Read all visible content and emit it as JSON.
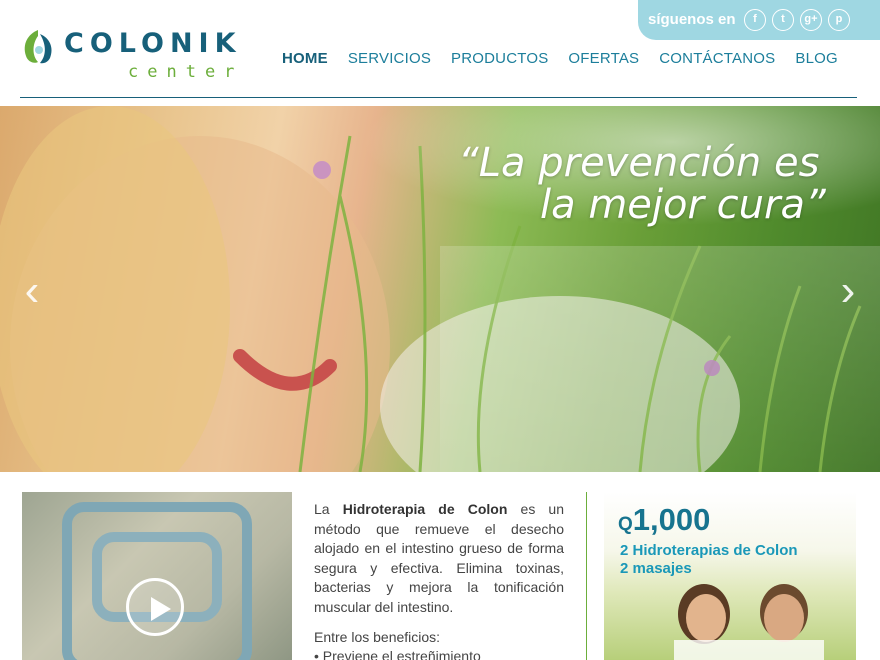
{
  "brand": {
    "name": "COLONIK",
    "sub": "center",
    "colors": {
      "primary": "#17607a",
      "accent": "#6cae3b",
      "link": "#1c7e9b",
      "social_bg": "#9fd7e2"
    }
  },
  "social": {
    "label": "síguenos en",
    "icons": [
      {
        "name": "facebook-icon",
        "glyph": "f"
      },
      {
        "name": "twitter-icon",
        "glyph": "t"
      },
      {
        "name": "google-plus-icon",
        "glyph": "g+"
      },
      {
        "name": "pinterest-icon",
        "glyph": "p"
      }
    ]
  },
  "nav": {
    "items": [
      {
        "label": "HOME",
        "active": true
      },
      {
        "label": "SERVICIOS",
        "active": false
      },
      {
        "label": "PRODUCTOS",
        "active": false
      },
      {
        "label": "OFERTAS",
        "active": false
      },
      {
        "label": "CONTÁCTANOS",
        "active": false
      },
      {
        "label": "BLOG",
        "active": false
      }
    ]
  },
  "hero": {
    "quote_line1": "“La prevención es",
    "quote_line2": "la mejor cura”",
    "prev_arrow": "‹",
    "next_arrow": "›"
  },
  "content": {
    "desc_prefix": "La ",
    "desc_bold": "Hidroterapia de Colon",
    "desc_rest": " es un método que remueve el desecho alojado en el intestino grueso de forma segura y efectiva. Elimina toxinas, bacterias y mejora la tonificación muscular del intestino.",
    "benefits_title": "Entre los beneficios:",
    "benefits": [
      "• Previene el estreñimiento"
    ]
  },
  "promo": {
    "currency": "Q",
    "amount": "1,000",
    "line1": "2 Hidroterapias de Colon",
    "line2": "2 masajes"
  }
}
